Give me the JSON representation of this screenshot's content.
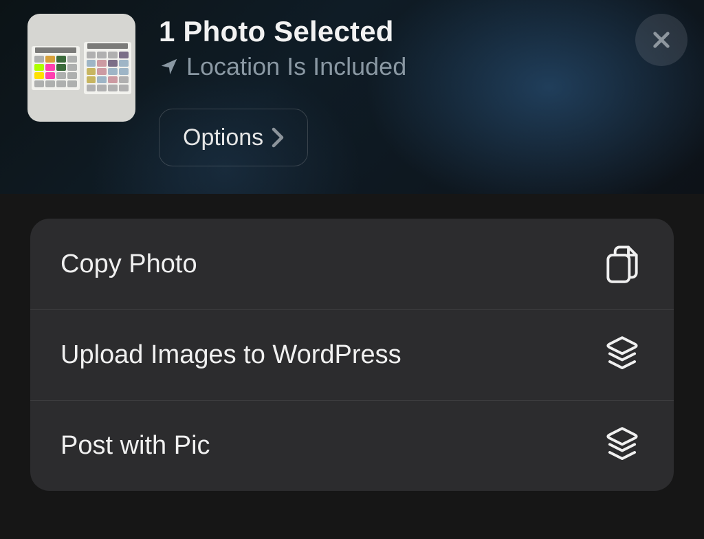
{
  "header": {
    "title": "1 Photo Selected",
    "subtitle": "Location Is Included",
    "options_label": "Options"
  },
  "actions": [
    {
      "label": "Copy Photo",
      "icon": "copy-icon"
    },
    {
      "label": "Upload Images to WordPress",
      "icon": "shortcuts-icon"
    },
    {
      "label": "Post with Pic",
      "icon": "shortcuts-icon"
    }
  ]
}
